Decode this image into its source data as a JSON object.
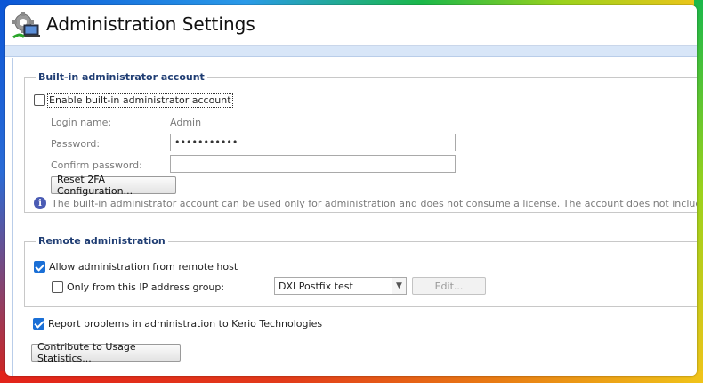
{
  "window": {
    "title": "Administration Settings"
  },
  "builtin_admin": {
    "legend": "Built-in administrator account",
    "enable_label": "Enable built-in administrator account",
    "enable_checked": false,
    "login_label": "Login name:",
    "login_value": "Admin",
    "password_label": "Password:",
    "password_value": "•••••••••••",
    "confirm_label": "Confirm password:",
    "confirm_value": "",
    "reset_2fa_label": "Reset 2FA Configuration...",
    "info_icon": "info-icon",
    "info_text": "The built-in administrator account can be used only for administration and does not consume a license. The account does not include a mailbox."
  },
  "remote_admin": {
    "legend": "Remote administration",
    "allow_label": "Allow administration from remote host",
    "allow_checked": true,
    "only_ip_label": "Only from this IP address group:",
    "only_ip_checked": false,
    "ip_group_selected": "DXI Postfix test",
    "edit_label": "Edit..."
  },
  "report": {
    "label": "Report problems in administration to Kerio Technologies",
    "checked": true
  },
  "contribute_label": "Contribute to Usage Statistics...",
  "colors": {
    "accent": "#1a6fd6",
    "legend": "#1f3d73",
    "info_icon": "#4a5bb4"
  }
}
